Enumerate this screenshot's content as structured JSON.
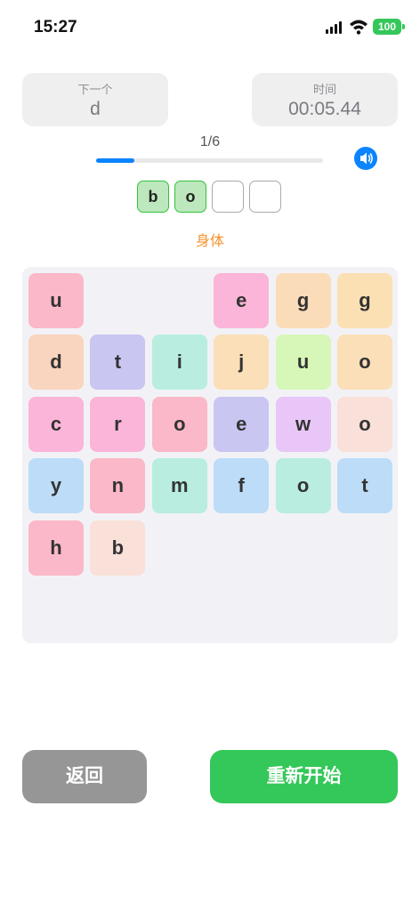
{
  "status_bar": {
    "time": "15:27",
    "battery": "100"
  },
  "next_card": {
    "label": "下一个",
    "value": "d"
  },
  "time_card": {
    "label": "时间",
    "value": "00:05.44"
  },
  "progress": {
    "text": "1/6",
    "fraction": 0.167
  },
  "word_slots": [
    "b",
    "o",
    "",
    ""
  ],
  "hint": "身体",
  "tiles": [
    {
      "letter": "u",
      "color": "#fbb8c8"
    },
    {
      "letter": "",
      "color": ""
    },
    {
      "letter": "",
      "color": ""
    },
    {
      "letter": "e",
      "color": "#fbb5d8"
    },
    {
      "letter": "g",
      "color": "#fbdcb8"
    },
    {
      "letter": "g",
      "color": "#fbe0b3"
    },
    {
      "letter": "d",
      "color": "#f9d4bf"
    },
    {
      "letter": "t",
      "color": "#c9c6f2"
    },
    {
      "letter": "i",
      "color": "#b8ede0"
    },
    {
      "letter": "j",
      "color": "#fbdfb8"
    },
    {
      "letter": "u",
      "color": "#d6f7b8"
    },
    {
      "letter": "o",
      "color": "#fbdfb8"
    },
    {
      "letter": "c",
      "color": "#fbb5d8"
    },
    {
      "letter": "r",
      "color": "#fbb5d8"
    },
    {
      "letter": "o",
      "color": "#fbb8c8"
    },
    {
      "letter": "e",
      "color": "#c9c6f2"
    },
    {
      "letter": "w",
      "color": "#e8c6f7"
    },
    {
      "letter": "o",
      "color": "#f9e0d8"
    },
    {
      "letter": "y",
      "color": "#bcdcf7"
    },
    {
      "letter": "n",
      "color": "#fbb8c8"
    },
    {
      "letter": "m",
      "color": "#b8ede0"
    },
    {
      "letter": "f",
      "color": "#bcdcf7"
    },
    {
      "letter": "o",
      "color": "#b8ede0"
    },
    {
      "letter": "t",
      "color": "#bcdcf7"
    },
    {
      "letter": "h",
      "color": "#fbb8c8"
    },
    {
      "letter": "b",
      "color": "#f9e0d8"
    }
  ],
  "buttons": {
    "back": "返回",
    "restart": "重新开始"
  },
  "colors": {
    "accent": "#0a84ff",
    "success": "#34c759",
    "hint": "#f5922b"
  }
}
